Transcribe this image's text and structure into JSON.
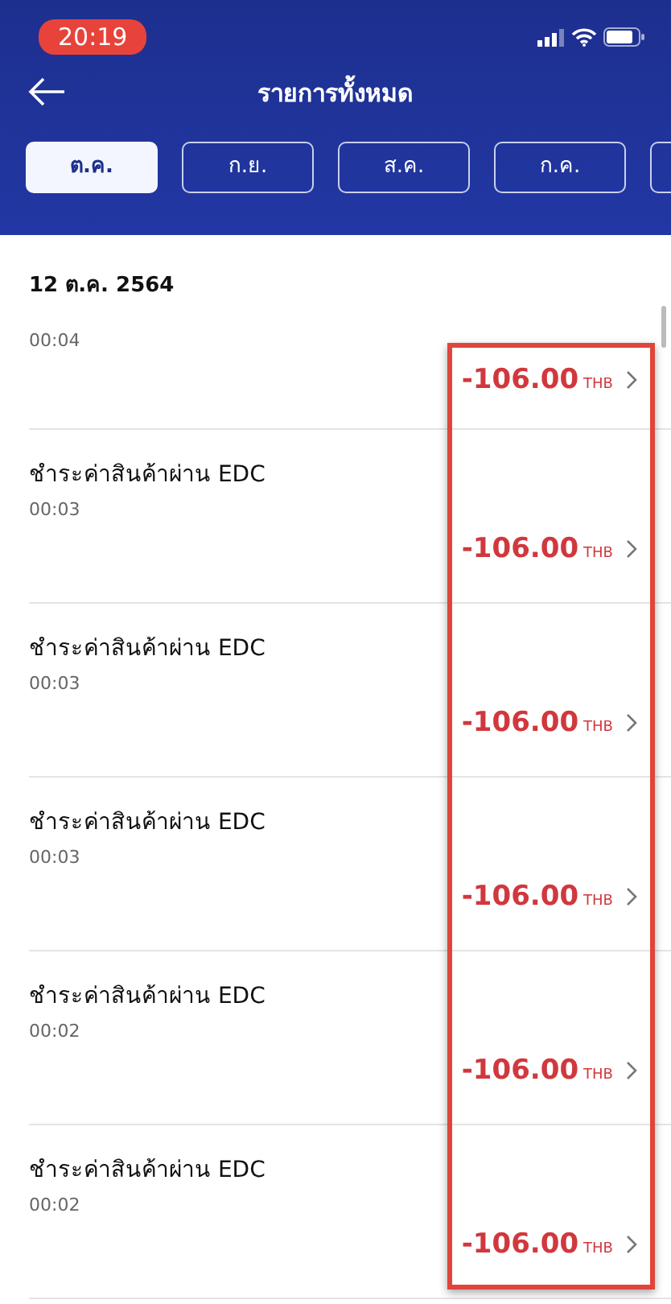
{
  "status_bar": {
    "time": "20:19"
  },
  "header": {
    "title": "รายการทั้งหมด"
  },
  "tabs": [
    {
      "label": "ต.ค.",
      "selected": true
    },
    {
      "label": "ก.ย.",
      "selected": false
    },
    {
      "label": "ส.ค.",
      "selected": false
    },
    {
      "label": "ก.ค.",
      "selected": false
    },
    {
      "selected": false
    }
  ],
  "date_header": "12 ต.ค. 2564",
  "transactions": [
    {
      "time": "00:04",
      "amount": "-106.00",
      "currency": "THB"
    },
    {
      "title": "ชำระค่าสินค้าผ่าน EDC",
      "time": "00:03",
      "amount": "-106.00",
      "currency": "THB"
    },
    {
      "title": "ชำระค่าสินค้าผ่าน EDC",
      "time": "00:03",
      "amount": "-106.00",
      "currency": "THB"
    },
    {
      "title": "ชำระค่าสินค้าผ่าน EDC",
      "time": "00:03",
      "amount": "-106.00",
      "currency": "THB"
    },
    {
      "title": "ชำระค่าสินค้าผ่าน EDC",
      "time": "00:02",
      "amount": "-106.00",
      "currency": "THB"
    },
    {
      "title": "ชำระค่าสินค้าผ่าน EDC",
      "time": "00:02",
      "amount": "-106.00",
      "currency": "THB"
    }
  ],
  "highlight_frame": true
}
